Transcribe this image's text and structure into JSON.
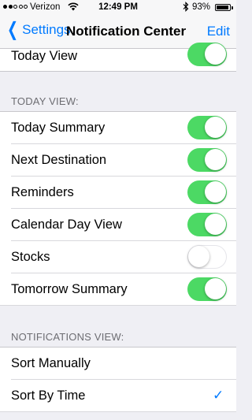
{
  "status_bar": {
    "carrier": "Verizon",
    "time": "12:49 PM",
    "battery": "93%",
    "battery_level": 0.93
  },
  "nav": {
    "back_label": "Settings",
    "title": "Notification Center",
    "edit_label": "Edit"
  },
  "top_row": {
    "label": "Today View",
    "on": true
  },
  "today_view": {
    "header": "TODAY VIEW:",
    "items": [
      {
        "label": "Today Summary",
        "on": true
      },
      {
        "label": "Next Destination",
        "on": true
      },
      {
        "label": "Reminders",
        "on": true
      },
      {
        "label": "Calendar Day View",
        "on": true
      },
      {
        "label": "Stocks",
        "on": false
      },
      {
        "label": "Tomorrow Summary",
        "on": true
      }
    ]
  },
  "notifications_view": {
    "header": "NOTIFICATIONS VIEW:",
    "items": [
      {
        "label": "Sort Manually",
        "selected": false
      },
      {
        "label": "Sort By Time",
        "selected": true
      }
    ],
    "check_icon": "✓"
  },
  "colors": {
    "accent": "#007aff",
    "toggle_on": "#4cd964",
    "background": "#efeff4"
  },
  "icons": {
    "back": "chevron-left-icon",
    "wifi": "wifi-icon",
    "bluetooth": "bluetooth-icon",
    "battery": "battery-icon",
    "check": "checkmark-icon"
  }
}
